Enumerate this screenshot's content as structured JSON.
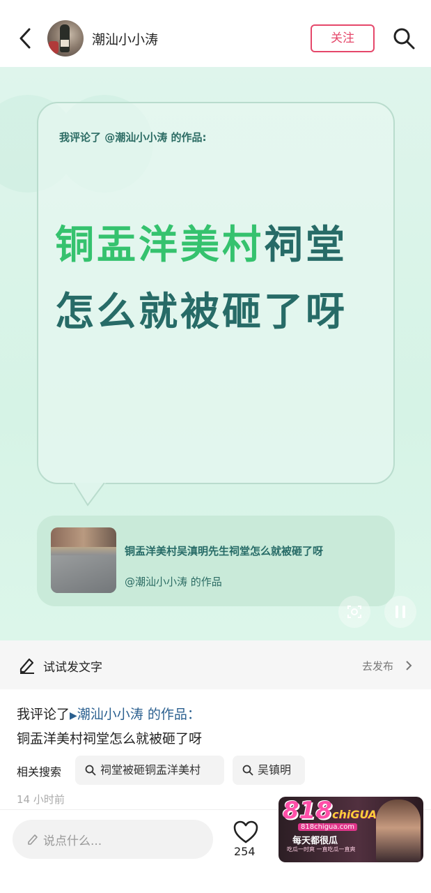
{
  "header": {
    "username": "潮汕小小涛",
    "follow_label": "关注"
  },
  "bubble": {
    "heading": "我评论了 @潮汕小小涛 的作品:",
    "big_text_highlight": "铜盂洋美村",
    "big_text_rest": "祠堂怎么就被砸了呀"
  },
  "video_card": {
    "title": "铜盂洋美村吴滇明先生祠堂怎么就被砸了呀",
    "author": "@潮汕小小涛 的作品"
  },
  "try_post": {
    "label": "试试发文字",
    "action": "去发布"
  },
  "post": {
    "prefix": "我评论了",
    "mention": "潮汕小小涛",
    "suffix": " 的作品：",
    "text": "铜盂洋美村祠堂怎么就被砸了呀",
    "related_label": "相关搜索",
    "related_searches": [
      "祠堂被砸铜盂洋美村",
      "吴镇明"
    ],
    "time": "14 小时前"
  },
  "bottom": {
    "comment_placeholder": "说点什么...",
    "like_count": "254"
  },
  "ad": {
    "logo": "818",
    "logo_small": "chiGUA",
    "url": "818chigua.com",
    "slogan": "每天都很瓜",
    "line": "吃瓜一时爽 一直吃瓜一直爽"
  },
  "colors": {
    "accent": "#e5476a",
    "highlight_green": "#35c26e",
    "text_teal": "#276b67",
    "mention_blue": "#2a5f8f"
  }
}
